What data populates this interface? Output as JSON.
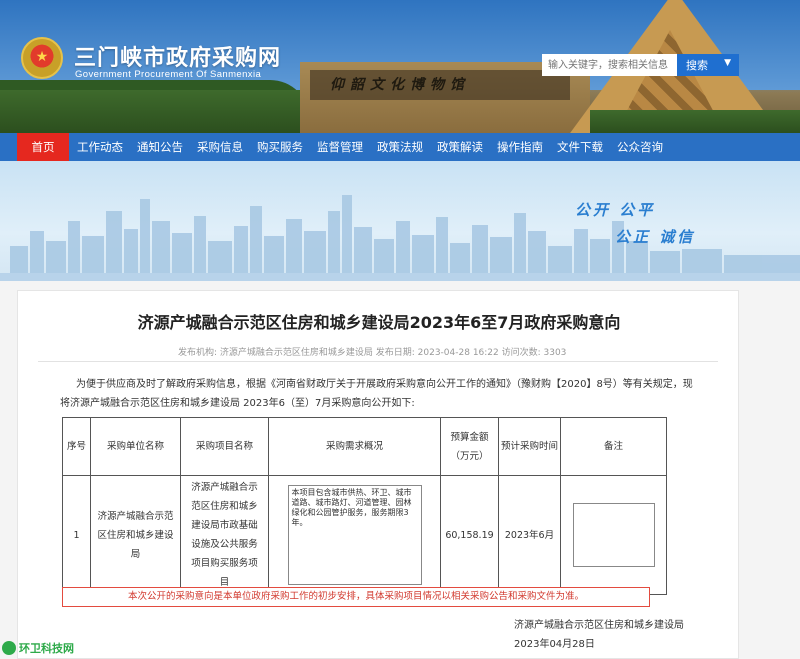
{
  "header": {
    "site_title": "三门峡市政府采购网",
    "site_subtitle": "Government Procurement Of Sanmenxia",
    "building_sign": "仰韶文化博物馆",
    "search": {
      "placeholder": "输入关键字，搜索相关信息",
      "button_label": "搜索"
    }
  },
  "nav": {
    "items": [
      {
        "label": "首页"
      },
      {
        "label": "工作动态"
      },
      {
        "label": "通知公告"
      },
      {
        "label": "采购信息"
      },
      {
        "label": "购买服务"
      },
      {
        "label": "监督管理"
      },
      {
        "label": "政策法规"
      },
      {
        "label": "政策解读"
      },
      {
        "label": "操作指南"
      },
      {
        "label": "文件下载"
      },
      {
        "label": "公众咨询"
      }
    ],
    "active_index": 0
  },
  "banner": {
    "motto1": "公开  公平",
    "motto2": "公正  诚信"
  },
  "article": {
    "title": "济源产城融合示范区住房和城乡建设局2023年6至7月政府采购意向",
    "meta": "发布机构:  济源产城融合示范区住房和城乡建设局     发布日期:  2023-04-28 16:22   访问次数:  3303",
    "intro": "为便于供应商及时了解政府采购信息，根据《河南省财政厅关于开展政府采购意向公开工作的通知》（豫财购【2020】8号）等有关规定，现将济源产城融合示范区住房和城乡建设局 2023年6（至）7月采购意向公开如下:",
    "table": {
      "headers": [
        "序号",
        "采购单位名称",
        "采购项目名称",
        "采购需求概况",
        "预算金额（万元）",
        "预计采购时间",
        "备注"
      ],
      "rows": [
        {
          "index": "1",
          "unit": "济源产城融合示范区住房和城乡建设局",
          "project": "济源产城融合示范区住房和城乡建设局市政基础设施及公共服务项目购买服务项目",
          "description": "本项目包含城市供热、环卫、城市道路、城市路灯、河道管理、园林绿化和公园管护服务，服务期限3年。",
          "budget": "60,158.19",
          "time": "2023年6月",
          "note": ""
        }
      ]
    },
    "notice": "本次公开的采购意向是本单位政府采购工作的初步安排，具体采购项目情况以相关采购公告和采购文件为准。",
    "sign_org": "济源产城融合示范区住房和城乡建设局",
    "sign_date": "2023年04月28日"
  },
  "watermark": "环卫科技网",
  "colors": {
    "nav_bg": "#2a70c4",
    "nav_active": "#e5281f",
    "notice_text": "#d23a2f",
    "search_btn": "#1f6fd0"
  }
}
